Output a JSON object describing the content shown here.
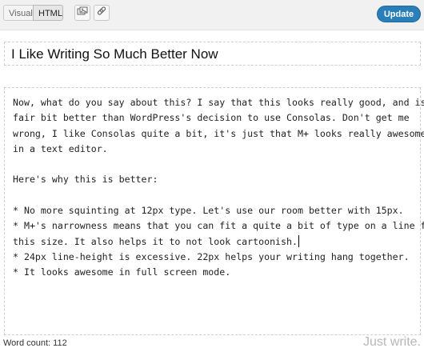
{
  "toolbar": {
    "visual_tab": "Visual",
    "html_tab": "HTML",
    "update_label": "Update",
    "icons": [
      "gallery-icon",
      "link-icon"
    ]
  },
  "post": {
    "title": "I Like Writing So Much Better Now"
  },
  "editor": {
    "lines": [
      "Now, what do you say about this? I say that this looks really good, and is a",
      "fair bit better than WordPress's decision to use Consolas. Don't get me",
      "wrong, I like Consolas quite a bit, it's just that M+ looks really awesome",
      "in a text editor.",
      "",
      "Here's why this is better:",
      "",
      "* No more squinting at 12px type. Let's use our room better with 15px.",
      "* M+'s narrowness means that you can fit a quite a bit of type on a line for",
      "this size. It also helps it to not look cartoonish.",
      "* 24px line-height is excessive. 22px helps your writing hang together.",
      "* It looks awesome in full screen mode."
    ]
  },
  "footer": {
    "word_count": "Word count: 112",
    "tagline": "Just write."
  },
  "colors": {
    "update_button": "#2a7fb8",
    "toolbar_bg": "#f1f1f1",
    "tagline": "#b8b8b8"
  }
}
